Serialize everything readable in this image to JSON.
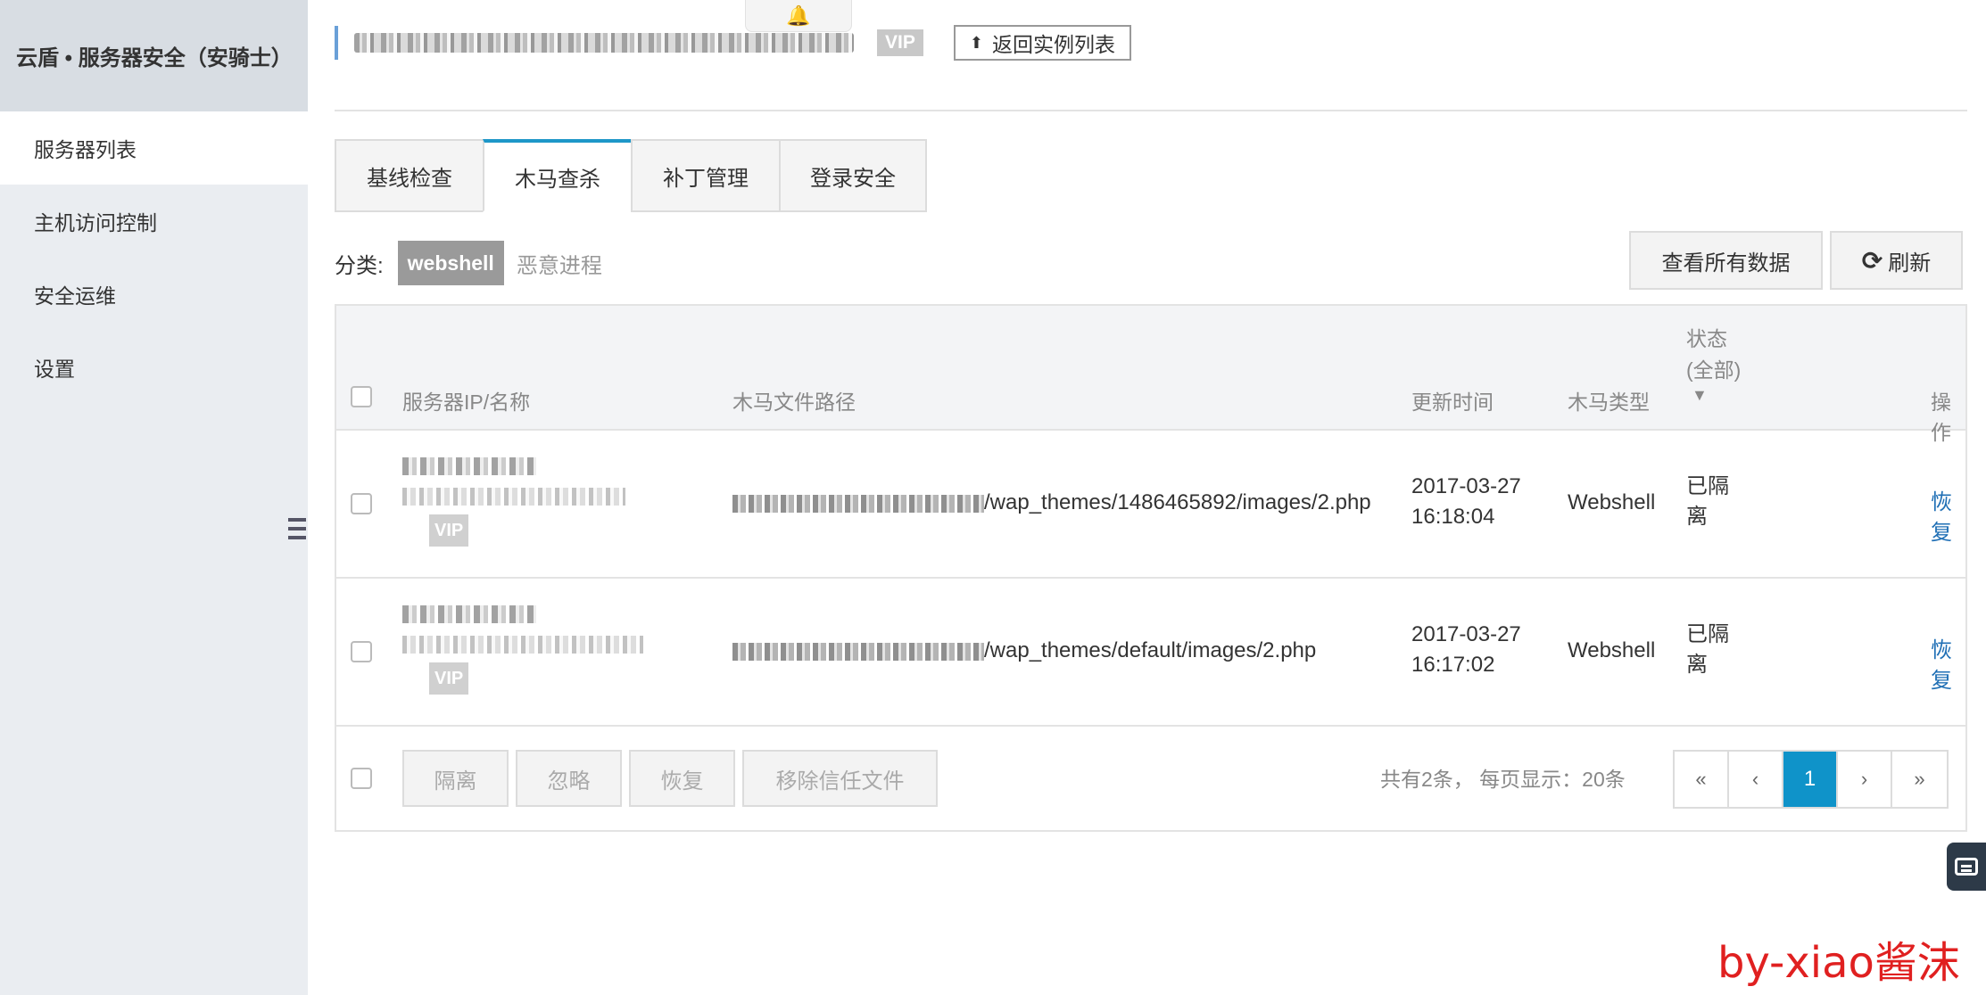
{
  "sidebar": {
    "title": "云盾 • 服务器安全（安骑士）",
    "items": [
      {
        "label": "服务器列表"
      },
      {
        "label": "主机访问控制"
      },
      {
        "label": "安全运维"
      },
      {
        "label": "设置"
      }
    ]
  },
  "header": {
    "vip_label": "VIP",
    "back_label": "返回实例列表"
  },
  "tabs": [
    {
      "label": "基线检查"
    },
    {
      "label": "木马查杀"
    },
    {
      "label": "补丁管理"
    },
    {
      "label": "登录安全"
    }
  ],
  "filter": {
    "label": "分类:",
    "active": "webshell",
    "other": "恶意进程"
  },
  "toolbar": {
    "view_all_label": "查看所有数据",
    "refresh_label": "刷新"
  },
  "table": {
    "columns": {
      "server": "服务器IP/名称",
      "path": "木马文件路径",
      "time": "更新时间",
      "type": "木马类型",
      "status_line1": "状态",
      "status_line2": "(全部)",
      "action": "操作"
    },
    "rows": [
      {
        "vip": "VIP",
        "path_suffix": "/wap_themes/1486465892/images/2.php",
        "date": "2017-03-27",
        "time": "16:18:04",
        "type": "Webshell",
        "status_line1": "已隔",
        "status_line2": "离",
        "action": "恢复"
      },
      {
        "vip": "VIP",
        "path_suffix": "/wap_themes/default/images/2.php",
        "date": "2017-03-27",
        "time": "16:17:02",
        "type": "Webshell",
        "status_line1": "已隔",
        "status_line2": "离",
        "action": "恢复"
      }
    ]
  },
  "footer": {
    "isolate": "隔离",
    "ignore": "忽略",
    "restore": "恢复",
    "remove_trust": "移除信任文件",
    "count_text": "共有2条，  每页显示：20条",
    "pager": {
      "first": "«",
      "prev": "‹",
      "current": "1",
      "next": "›",
      "last": "»"
    }
  },
  "watermark": "by-xiao酱沫",
  "colors": {
    "accent": "#0f93c9",
    "link": "#1f6fb5",
    "tab_active": "#1e97c8"
  }
}
